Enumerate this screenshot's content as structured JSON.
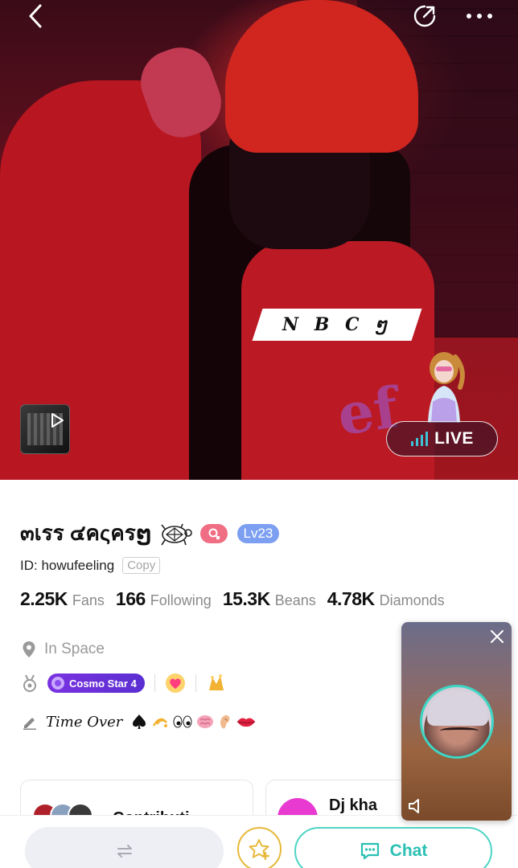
{
  "header": {
    "back_icon": "chevron-left-icon",
    "share_icon": "share-arrow-icon",
    "more_icon": "more-dots-icon"
  },
  "hero": {
    "overlay_tag": "N B C ໆ",
    "video_thumb_icon": "play-icon",
    "live_label": "LIVE",
    "live_icon": "signal-bars-icon",
    "colors": {
      "live_bars": "#3fc1d8",
      "hero_tint": "#a0151e"
    }
  },
  "profile": {
    "name": "๓เรร ๔คςครໆ",
    "gender_icon": "female-icon",
    "level": "Lv23",
    "id_text": "ID: howufeeling",
    "copy_label": "Copy",
    "stats": [
      {
        "value": "2.25K",
        "label": "Fans"
      },
      {
        "value": "166",
        "label": "Following"
      },
      {
        "value": "15.3K",
        "label": "Beans"
      },
      {
        "value": "4.78K",
        "label": "Diamonds"
      }
    ],
    "location": "In Space",
    "location_icon": "map-pin-icon",
    "medal_icon": "medal-icon",
    "cosmo_badge": "Cosmo Star 4",
    "bio": "Time Over",
    "bio_icon": "pencil-icon",
    "colors": {
      "gender": "#f06e84",
      "level": "#7d9ff2",
      "cosmo": "#6a30dc"
    }
  },
  "cards": {
    "contribution_label": "Contributi",
    "dj_name": "Dj kha"
  },
  "bottom_bar": {
    "switch_icon": "swap-arrows-icon",
    "favorite_icon": "star-plus-icon",
    "chat_label": "Chat",
    "chat_icon": "chat-bubble-icon",
    "colors": {
      "chat": "#2ac0b2",
      "favorite": "#e6b93a"
    }
  },
  "mini_player": {
    "close_icon": "close-icon",
    "mute_icon": "speaker-icon"
  }
}
